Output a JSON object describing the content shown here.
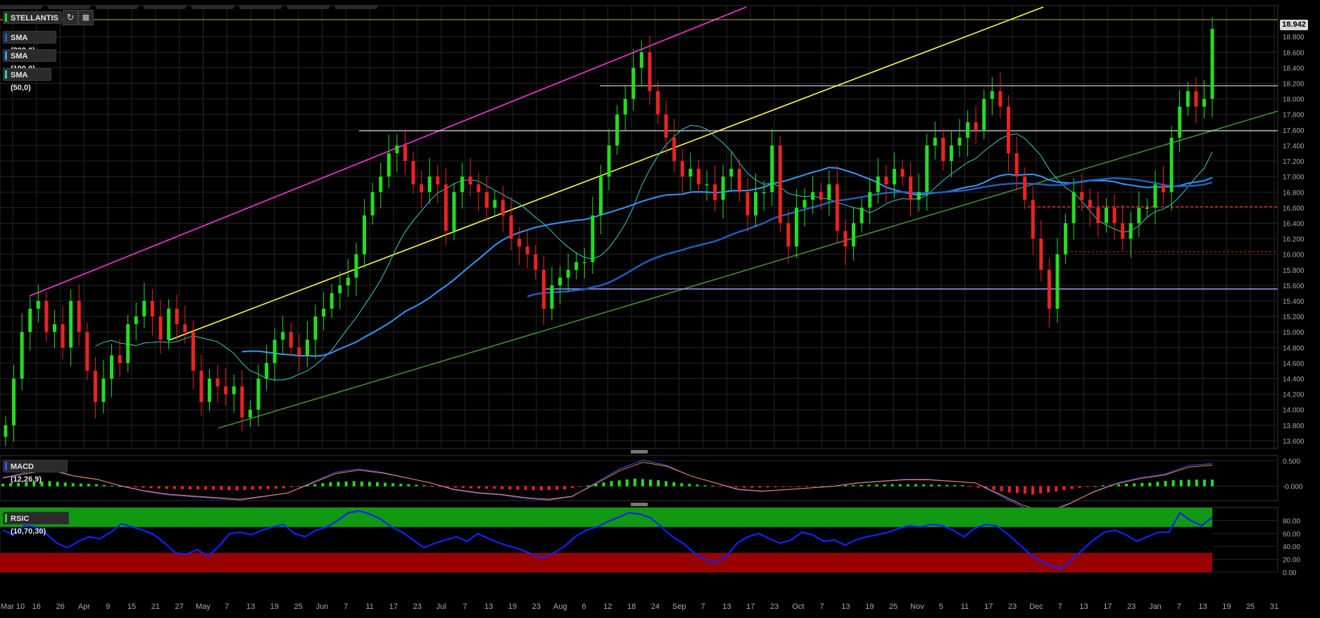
{
  "toolbar": {
    "symbol": "STELLANTIS",
    "refresh_icon": "refresh-icon",
    "calendar_icon": "calendar-icon"
  },
  "indicators": [
    {
      "label": "SMA (200,0)",
      "color": "#1f5fbf"
    },
    {
      "label": "SMA (100,0)",
      "color": "#3399ff"
    },
    {
      "label": "SMA (50,0)",
      "color": "#33cccc"
    }
  ],
  "panels": {
    "macd_label": "MACD (12,26,9)",
    "rsi_label": "RSIC (10,70,30)"
  },
  "last_price": "18.942",
  "colors": {
    "up": "#22dd22",
    "down": "#ee2222",
    "sma200": "#1f5fbf",
    "sma100": "#3399ff",
    "sma50": "#33cccc",
    "trend_magenta": "#ff33dd",
    "trend_yellow": "#ffff44",
    "trend_green": "#3f8f2f",
    "resistance_white": "#ffffff",
    "support_lavender": "#a0a0ff",
    "support_red": "#ee2222",
    "rsi_overbought": "#119911",
    "rsi_oversold": "#990000",
    "rsi_line": "#1122ff"
  },
  "chart_data": [
    {
      "type": "candlestick",
      "title": "STELLANTIS",
      "ylim": [
        13.5,
        19.2
      ],
      "y_ticks": [
        "13.600",
        "13.800",
        "14.000",
        "14.200",
        "14.400",
        "14.600",
        "14.800",
        "15.000",
        "15.200",
        "15.400",
        "15.600",
        "15.800",
        "16.000",
        "16.200",
        "16.400",
        "16.600",
        "16.800",
        "17.000",
        "17.200",
        "17.400",
        "17.600",
        "17.800",
        "18.000",
        "18.200",
        "18.400",
        "18.600",
        "18.800",
        "18.942"
      ],
      "x_ticks": [
        "Mar 10",
        "16",
        "26",
        "Apr",
        "9",
        "15",
        "21",
        "27",
        "May",
        "7",
        "13",
        "19",
        "25",
        "Jun",
        "7",
        "11",
        "17",
        "23",
        "Jul",
        "7",
        "13",
        "19",
        "23",
        "Aug",
        "6",
        "12",
        "18",
        "24",
        "Sep",
        "7",
        "13",
        "17",
        "23",
        "Oct",
        "7",
        "13",
        "19",
        "25",
        "Nov",
        "5",
        "11",
        "17",
        "23",
        "Dec",
        "7",
        "13",
        "17",
        "23",
        "Jan",
        "7",
        "13",
        "19",
        "25",
        "31"
      ],
      "series": [
        {
          "name": "STELLANTIS",
          "values": [
            13.8,
            14.4,
            15.0,
            15.3,
            15.4,
            15.0,
            15.1,
            14.8,
            15.4,
            15.0,
            14.5,
            14.1,
            14.4,
            14.7,
            14.6,
            15.1,
            15.2,
            15.4,
            15.2,
            14.9,
            15.3,
            15.1,
            15.0,
            14.5,
            14.1,
            14.4,
            14.3,
            14.2,
            14.3,
            13.9,
            14.0,
            14.4,
            14.6,
            14.9,
            15.0,
            14.8,
            14.7,
            14.9,
            15.2,
            15.3,
            15.5,
            15.6,
            15.7,
            16.0,
            16.5,
            16.8,
            17.0,
            17.3,
            17.4,
            17.2,
            16.9,
            16.8,
            17.0,
            16.9,
            16.3,
            16.8,
            17.0,
            16.9,
            16.8,
            16.6,
            16.7,
            16.5,
            16.2,
            16.1,
            16.0,
            15.8,
            15.3,
            15.6,
            15.7,
            15.8,
            15.9,
            15.9,
            16.5,
            17.0,
            17.4,
            17.8,
            18.0,
            18.4,
            18.6,
            18.1,
            17.8,
            17.5,
            17.2,
            17.0,
            17.1,
            16.9,
            16.9,
            16.7,
            17.0,
            17.1,
            16.8,
            16.5,
            16.8,
            16.8,
            17.4,
            16.4,
            16.1,
            16.6,
            16.7,
            16.8,
            16.7,
            16.9,
            16.3,
            16.1,
            16.4,
            16.6,
            16.8,
            17.0,
            16.9,
            17.1,
            17.0,
            16.7,
            16.8,
            17.4,
            17.5,
            17.2,
            17.4,
            17.5,
            17.7,
            17.6,
            18.0,
            18.1,
            17.9,
            17.3,
            17.0,
            16.7,
            16.2,
            15.8,
            15.3,
            16.0,
            16.4,
            16.8,
            16.7,
            16.6,
            16.4,
            16.6,
            16.4,
            16.2,
            16.4,
            16.6,
            16.6,
            16.9,
            16.8,
            17.5,
            17.9,
            18.1,
            17.9,
            18.0,
            18.9
          ]
        }
      ],
      "overlays": [
        "SMA (200,0)",
        "SMA (100,0)",
        "SMA (50,0)"
      ],
      "last_price": 18.942,
      "grid": true
    },
    {
      "type": "bar",
      "title": "MACD (12,26,9)",
      "ylim": [
        -0.28,
        0.6
      ],
      "y_ticks": [
        "0.500",
        "-0.000"
      ],
      "series": [
        {
          "name": "MACD (12,26,9)",
          "values": [
            0.05,
            0.08,
            0.1,
            0.06,
            0.04,
            0.0,
            -0.03,
            -0.05,
            -0.06,
            -0.07,
            -0.08,
            -0.06,
            -0.04,
            0.02,
            0.08,
            0.1,
            0.08,
            0.05,
            0.02,
            -0.02,
            -0.04,
            -0.05,
            -0.07,
            -0.08,
            -0.06,
            0.02,
            0.1,
            0.15,
            0.12,
            0.06,
            0.02,
            -0.02,
            -0.03,
            -0.02,
            -0.01,
            0.0,
            0.02,
            0.03,
            0.04,
            0.04,
            0.03,
            0.02,
            -0.05,
            -0.12,
            -0.16,
            -0.1,
            -0.03,
            0.02,
            0.05,
            0.07,
            0.12,
            0.13
          ]
        }
      ]
    },
    {
      "type": "line",
      "title": "RSIC (10,70,30)",
      "ylim": [
        0,
        100
      ],
      "y_ticks": [
        "80.00",
        "60.00",
        "40.00",
        "20.00",
        "0.00"
      ],
      "series": [
        {
          "name": "RSIC (10,70,30)",
          "values": [
            65,
            58,
            72,
            70,
            60,
            45,
            38,
            48,
            55,
            52,
            62,
            75,
            70,
            65,
            58,
            45,
            30,
            28,
            35,
            25,
            40,
            60,
            62,
            58,
            65,
            70,
            74,
            60,
            55,
            65,
            70,
            80,
            92,
            95,
            90,
            82,
            70,
            62,
            50,
            38,
            45,
            50,
            55,
            48,
            60,
            52,
            45,
            40,
            35,
            28,
            22,
            30,
            40,
            55,
            65,
            70,
            78,
            85,
            92,
            90,
            84,
            70,
            55,
            45,
            30,
            20,
            15,
            25,
            45,
            55,
            60,
            52,
            45,
            50,
            62,
            58,
            48,
            50,
            42,
            50,
            55,
            58,
            62,
            68,
            72,
            70,
            74,
            72,
            65,
            55,
            68,
            74,
            72,
            60,
            45,
            30,
            18,
            10,
            5,
            20,
            35,
            50,
            62,
            65,
            58,
            48,
            55,
            62,
            62,
            92,
            80,
            72,
            85
          ]
        }
      ],
      "bands": {
        "overbought": 70,
        "oversold": 30
      }
    }
  ]
}
